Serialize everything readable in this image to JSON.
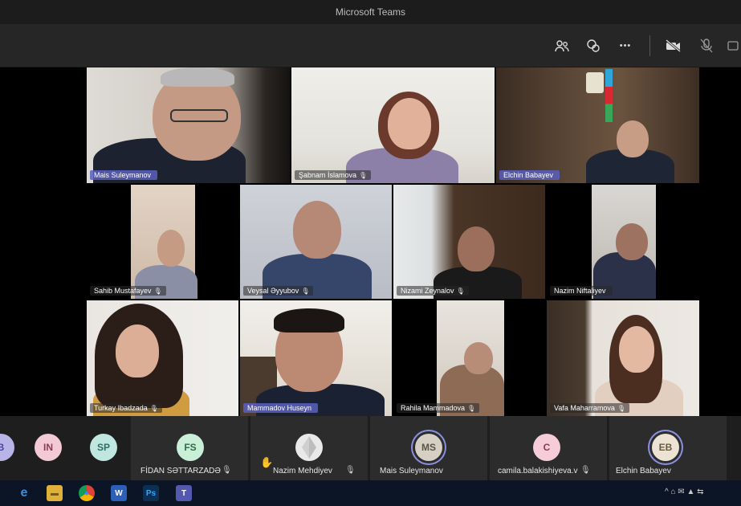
{
  "window": {
    "title": "Microsoft Teams"
  },
  "toolbar": {
    "icons": [
      "participants-icon",
      "raise-hand-icon",
      "more-options-icon",
      "camera-off-icon",
      "mic-off-icon",
      "share-tray-icon"
    ],
    "more_label": "•••"
  },
  "videos": [
    {
      "name": "Mais Suleymanov",
      "mic": "",
      "active": true
    },
    {
      "name": "Şabnam İslamova",
      "mic": "🎙",
      "active": false
    },
    {
      "name": "Elchin Babayev",
      "mic": "",
      "active": true
    },
    {
      "name": "Sahib Mustafayev",
      "mic": "🎙",
      "active": false
    },
    {
      "name": "Veysal Əyyubov",
      "mic": "🎙",
      "active": false
    },
    {
      "name": "Nizami Zeynalov",
      "mic": "🎙",
      "active": false
    },
    {
      "name": "Nazim Niftaliyev",
      "mic": "",
      "active": false
    },
    {
      "name": "Turkay Ibadzada",
      "mic": "🎙",
      "active": false
    },
    {
      "name": "Mammadov Huseyn",
      "mic": "",
      "active": true
    },
    {
      "name": "Rahila Mammadova",
      "mic": "🎙",
      "active": false
    },
    {
      "name": "Vafa Maharramova",
      "mic": "🎙",
      "active": false
    }
  ],
  "participants": [
    {
      "initials": "B",
      "name": "",
      "color": "#b9b4e8"
    },
    {
      "initials": "IN",
      "name": "",
      "color": "#f3c9d6"
    },
    {
      "initials": "SP",
      "name": "",
      "color": "#bfe6df"
    },
    {
      "initials": "FS",
      "name": "FİDAN SƏTTARZADƏ",
      "mic": "🎙",
      "color": "#c9efd9"
    },
    {
      "initials": "",
      "name": "Nazim Mehdiyev",
      "mic": "🎙",
      "hand": "✋",
      "color": "#e9e9e9"
    },
    {
      "initials": "MS",
      "name": "Mais Suleymanov",
      "color": "#d6d0c4"
    },
    {
      "initials": "C",
      "name": "camila.balakishiyeva.v",
      "mic": "🎙",
      "color": "#f6ccd8"
    },
    {
      "initials": "EB",
      "name": "Elchin Babayev",
      "color": "#ece3d4"
    }
  ],
  "taskbar": {
    "apps": [
      {
        "icon": "edge-icon",
        "glyph": "e",
        "color": "#1f6fd1"
      },
      {
        "icon": "file-explorer-icon",
        "glyph": "▬",
        "color": "#e0b13a"
      },
      {
        "icon": "chrome-icon",
        "glyph": "●",
        "color": "#3d9b4a"
      },
      {
        "icon": "word-icon",
        "glyph": "W",
        "color": "#2b5fb8"
      },
      {
        "icon": "photoshop-icon",
        "glyph": "Ps",
        "color": "#0d2f52"
      },
      {
        "icon": "teams-icon",
        "glyph": "T",
        "color": "#5558af"
      }
    ],
    "tray": "^ ⌂ ✉ ▲ ⇆"
  }
}
